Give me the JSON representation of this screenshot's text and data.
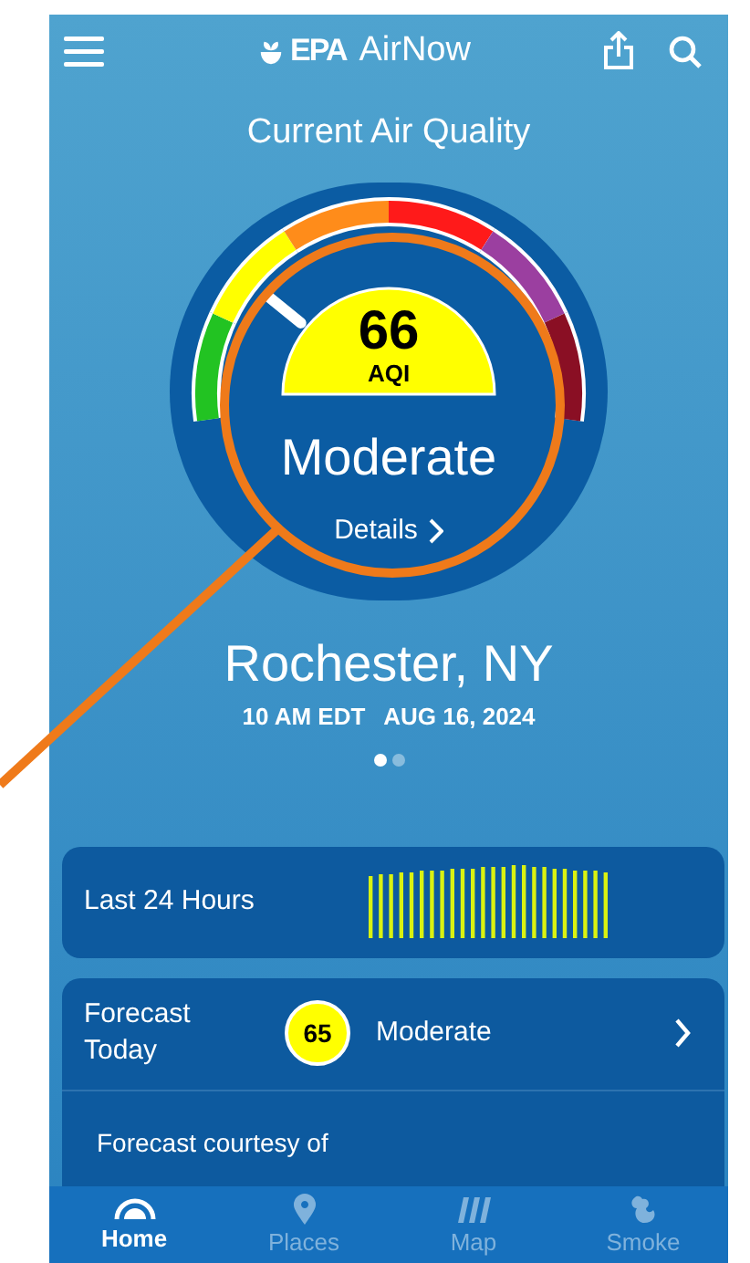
{
  "header": {
    "logo": "EPA",
    "title": "AirNow"
  },
  "heading": "Current Air Quality",
  "gauge": {
    "aqi": "66",
    "unit": "AQI",
    "category": "Moderate",
    "details": "Details",
    "level": 0.24
  },
  "location": {
    "name": "Rochester, NY",
    "time": "10 AM EDT",
    "date": "AUG 16, 2024"
  },
  "pager": [
    {
      "selected": true
    },
    {
      "selected": false
    }
  ],
  "last_24_hours": {
    "label": "Last 24 Hours"
  },
  "forecast": {
    "label": "Forecast Today",
    "aqi": "65",
    "category": "Moderate",
    "courtesy": "Forecast courtesy of"
  },
  "nav": [
    {
      "label": "Home",
      "selected": true
    },
    {
      "label": "Places",
      "selected": false
    },
    {
      "label": "Map",
      "selected": false
    },
    {
      "label": "Smoke",
      "selected": false
    }
  ]
}
